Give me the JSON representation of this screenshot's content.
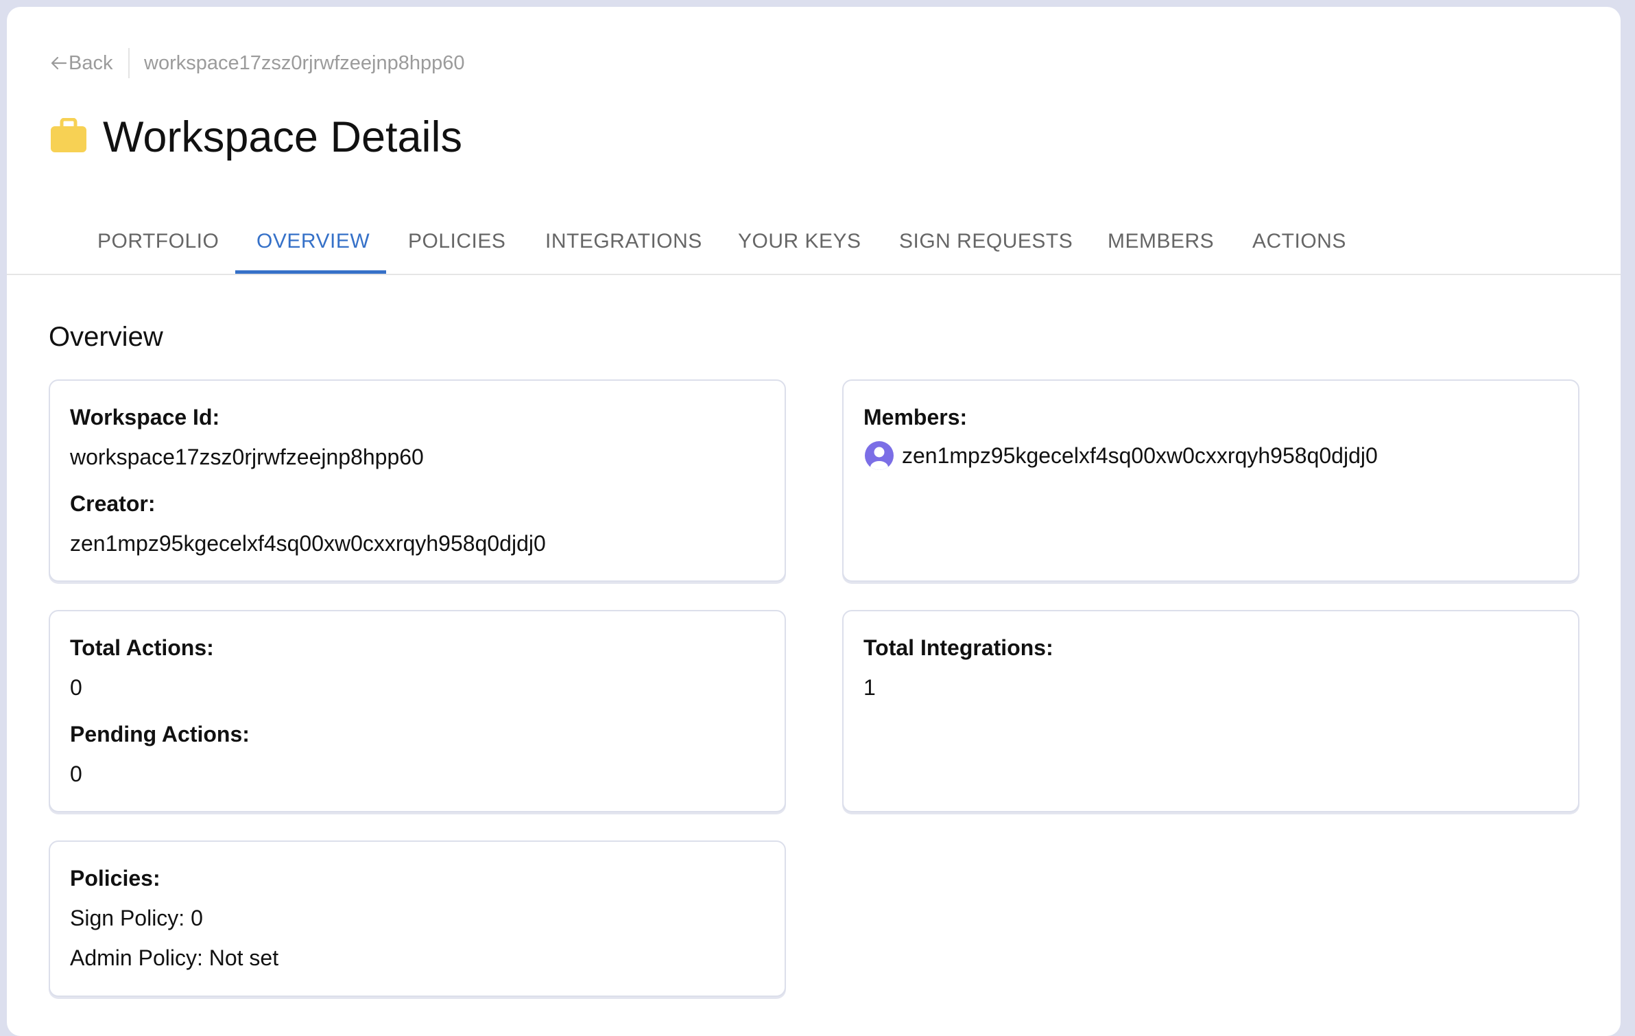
{
  "header": {
    "back_label": "Back",
    "breadcrumb_id": "workspace17zsz0rjrwfzeejnp8hpp60",
    "title": "Workspace Details",
    "title_icon": "briefcase-icon",
    "title_icon_color": "#F7D154"
  },
  "tabs": [
    {
      "label": "PORTFOLIO",
      "active": false
    },
    {
      "label": "OVERVIEW",
      "active": true
    },
    {
      "label": "POLICIES",
      "active": false
    },
    {
      "label": "INTEGRATIONS",
      "active": false
    },
    {
      "label": "YOUR KEYS",
      "active": false
    },
    {
      "label": "SIGN REQUESTS",
      "active": false
    },
    {
      "label": "MEMBERS",
      "active": false
    },
    {
      "label": "ACTIONS",
      "active": false
    }
  ],
  "colors": {
    "accent": "#3671C8",
    "avatar": "#7B6EE6",
    "background": "#DCDFEE"
  },
  "overview": {
    "heading": "Overview",
    "workspace_card": {
      "id_label": "Workspace Id:",
      "id_value": "workspace17zsz0rjrwfzeejnp8hpp60",
      "creator_label": "Creator:",
      "creator_value": "zen1mpz95kgecelxf4sq00xw0cxxrqyh958q0djdj0"
    },
    "members_card": {
      "label": "Members:",
      "members": [
        {
          "address": "zen1mpz95kgecelxf4sq00xw0cxxrqyh958q0djdj0",
          "icon": "user-avatar-icon"
        }
      ]
    },
    "actions_card": {
      "total_label": "Total Actions:",
      "total_value": "0",
      "pending_label": "Pending Actions:",
      "pending_value": "0"
    },
    "integrations_card": {
      "label": "Total Integrations:",
      "value": "1"
    },
    "policies_card": {
      "label": "Policies:",
      "sign_policy": "Sign Policy: 0",
      "admin_policy": "Admin Policy: Not set"
    }
  }
}
